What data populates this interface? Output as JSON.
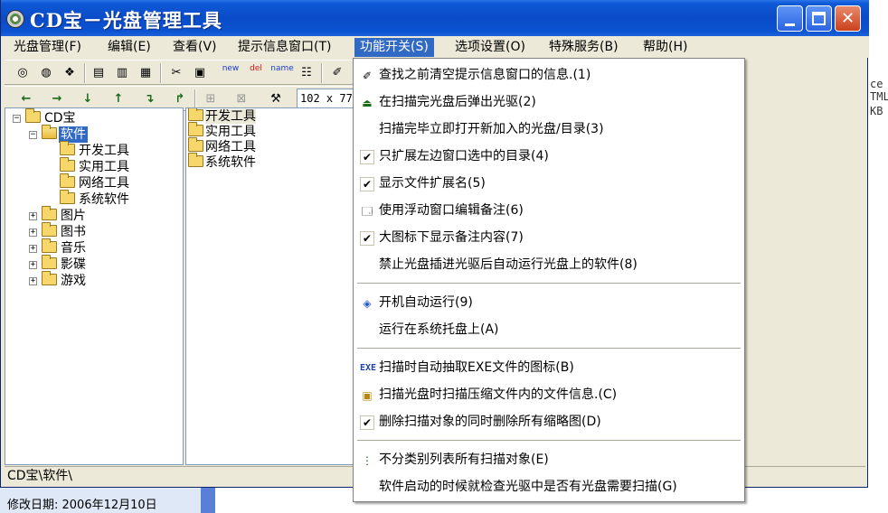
{
  "window": {
    "title": "CD宝－光盘管理工具"
  },
  "menubar": {
    "items": [
      {
        "label": "光盘管理(F)"
      },
      {
        "label": "编辑(E)"
      },
      {
        "label": "查看(V)"
      },
      {
        "label": "提示信息窗口(T)"
      },
      {
        "label": "功能开关(S)"
      },
      {
        "label": "选项设置(O)"
      },
      {
        "label": "特殊服务(B)"
      },
      {
        "label": "帮助(H)"
      }
    ]
  },
  "toolbar": {
    "zoom_value": "102 x 77",
    "new_label": "new",
    "del_label": "del",
    "name_label": "name"
  },
  "tree": {
    "root": "CD宝",
    "software": "软件",
    "software_children": [
      "开发工具",
      "实用工具",
      "网络工具",
      "系统软件"
    ],
    "others": [
      "图片",
      "图书",
      "音乐",
      "影碟",
      "游戏"
    ]
  },
  "list": {
    "items": [
      "开发工具",
      "实用工具",
      "网络工具",
      "系统软件"
    ]
  },
  "statusbar": {
    "path": "CD宝\\软件\\"
  },
  "behind": {
    "date_text": "修改日期: 2006年12月10日",
    "right_fragments": [
      "ce",
      "TML",
      "KB"
    ]
  },
  "dropdown": {
    "items": [
      {
        "label": "查找之前清空提示信息窗口的信息.(1)",
        "icon": "eraser-icon",
        "checked": false
      },
      {
        "label": "在扫描完光盘后弹出光驱(2)",
        "icon": "eject-icon",
        "checked": false
      },
      {
        "label": "扫描完毕立即打开新加入的光盘/目录(3)",
        "icon": "",
        "checked": false
      },
      {
        "label": "只扩展左边窗口选中的目录(4)",
        "icon": "",
        "checked": true
      },
      {
        "label": "显示文件扩展名(5)",
        "icon": "",
        "checked": true
      },
      {
        "label": "使用浮动窗口编辑备注(6)",
        "icon": "window-icon",
        "checked": false
      },
      {
        "label": "大图标下显示备注内容(7)",
        "icon": "",
        "checked": true
      },
      {
        "label": "禁止光盘插进光驱后自动运行光盘上的软件(8)",
        "icon": "",
        "checked": false
      },
      {
        "label": "开机自动运行(9)",
        "icon": "startup-icon",
        "checked": false
      },
      {
        "label": "运行在系统托盘上(A)",
        "icon": "",
        "checked": false
      },
      {
        "label": "扫描时自动抽取EXE文件的图标(B)",
        "icon": "exe-icon",
        "checked": false
      },
      {
        "label": "扫描光盘时扫描压缩文件内的文件信息.(C)",
        "icon": "archive-icon",
        "checked": false
      },
      {
        "label": "删除扫描对象的同时删除所有缩略图(D)",
        "icon": "",
        "checked": true
      },
      {
        "label": "不分类别列表所有扫描对象(E)",
        "icon": "tree-list-icon",
        "checked": false
      },
      {
        "label": "软件启动的时候就检查光驱中是否有光盘需要扫描(G)",
        "icon": "",
        "checked": false
      }
    ],
    "checkmark": "✔",
    "exe_text": "EXE"
  }
}
